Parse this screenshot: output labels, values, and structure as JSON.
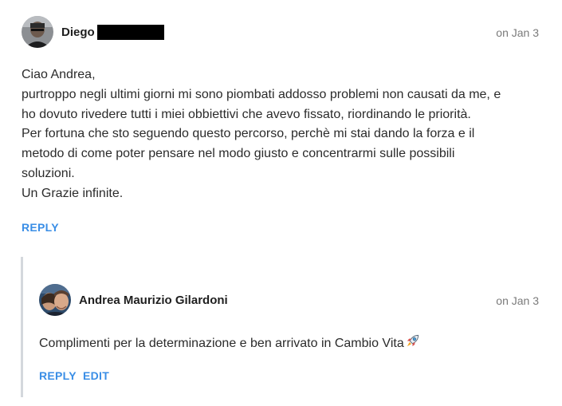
{
  "comment": {
    "author": "Diego",
    "timestamp": "on Jan 3",
    "lines": [
      "Ciao Andrea,",
      "purtroppo negli ultimi giorni mi sono piombati addosso problemi non causati da me, e",
      "ho dovuto rivedere tutti i miei obbiettivi che avevo fissato, riordinando le priorità.",
      "Per fortuna che sto seguendo questo percorso, perchè mi stai dando la forza e il",
      "metodo di come poter pensare nel modo giusto e concentrarmi sulle possibili",
      "soluzioni.",
      "Un Grazie infinite."
    ],
    "reply_label": "REPLY"
  },
  "reply": {
    "author": "Andrea Maurizio Gilardoni",
    "timestamp": "on Jan 3",
    "text": "Complimenti per la determinazione e ben arrivato in Cambio Vita",
    "emoji": "rocket-icon",
    "reply_label": "REPLY",
    "edit_label": "EDIT"
  },
  "colors": {
    "action": "#3a8ee6",
    "timestamp": "#7a7a7a",
    "thread_line": "#d4d8dd",
    "redaction": "#000000"
  }
}
